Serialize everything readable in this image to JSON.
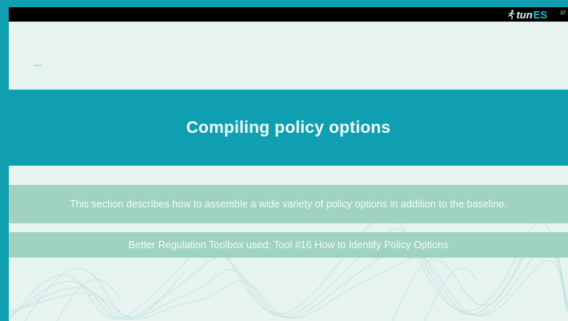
{
  "header": {
    "logo_prefix": "tun",
    "logo_suffix": "ES",
    "slide_number": "37"
  },
  "slide": {
    "title": "Compiling policy options",
    "description": "This section describes how to assemble  a wide variety of policy options in addition to the baseline.",
    "toolbox_note": "Better Regulation Toolbox used: Tool #16 How to Identify Policy Options"
  },
  "colors": {
    "frame": "#0f9fb0",
    "slide_background": "#e6f3ef",
    "title_band": "#0f9fb0",
    "info_bands": "#9fd3c0",
    "top_bar": "#000000"
  },
  "icons": {
    "logo_figure": "running-figure-icon"
  }
}
